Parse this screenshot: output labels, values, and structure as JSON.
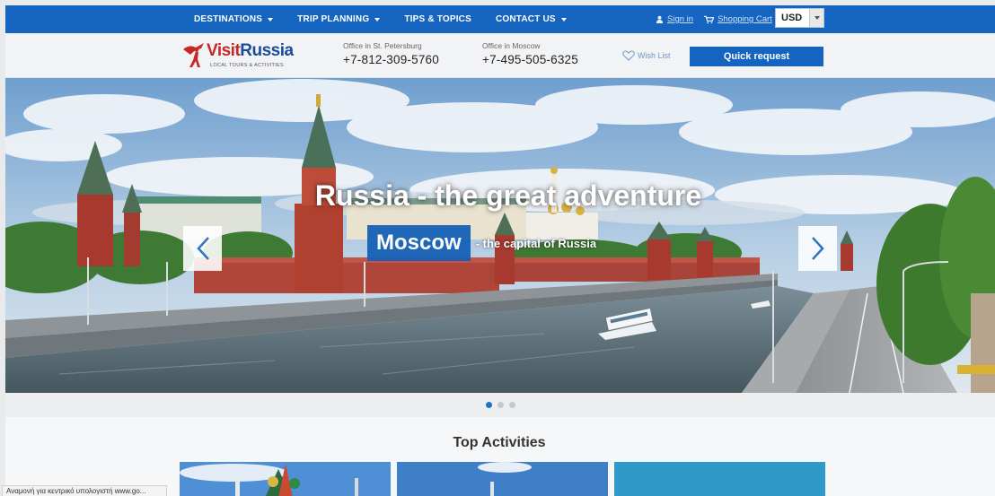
{
  "nav": {
    "items": [
      {
        "label": "DESTINATIONS",
        "has_caret": true
      },
      {
        "label": "TRIP PLANNING",
        "has_caret": true
      },
      {
        "label": "TIPS & TOPICS",
        "has_caret": false
      },
      {
        "label": "CONTACT US",
        "has_caret": true
      }
    ],
    "sign_in": "Sign in",
    "shopping_cart": "Shopping Cart",
    "currency": "USD"
  },
  "header": {
    "logo_visit": "Visit",
    "logo_russia": "Russia",
    "logo_tagline": "LOCAL TOURS & ACTIVITIES",
    "office_spb_label": "Office in St. Petersburg",
    "office_spb_phone": "+7-812-309-5760",
    "office_msk_label": "Office in Moscow",
    "office_msk_phone": "+7-495-505-6325",
    "wish_list": "Wish List",
    "quick_request": "Quick request"
  },
  "hero": {
    "title": "Russia - the great adventure",
    "city": "Moscow",
    "tagline": "- the capital of Russia",
    "slide_count": 3,
    "active_slide": 0
  },
  "activities": {
    "title": "Top Activities"
  },
  "status_bar": {
    "text": "Αναμονή για κεντρικό υπολογιστή www.go..."
  },
  "colors": {
    "brand_blue": "#1565c0",
    "logo_red": "#c62828",
    "logo_blue": "#1a4c9c"
  }
}
